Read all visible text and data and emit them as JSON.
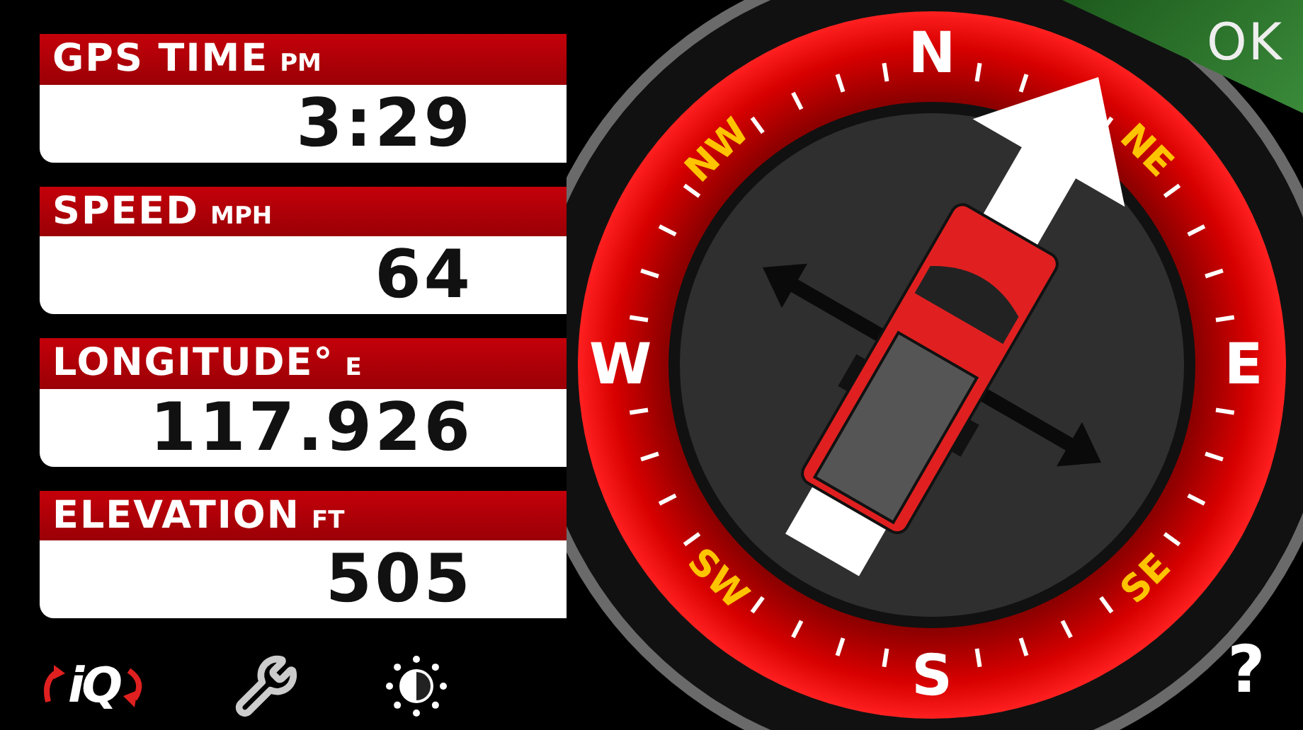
{
  "readouts": [
    {
      "label": "GPS TIME",
      "unit": "PM",
      "value": "3:29"
    },
    {
      "label": "SPEED",
      "unit": "MPH",
      "value": "64"
    },
    {
      "label": "LONGITUDE°",
      "unit": "E",
      "value": "117.926"
    },
    {
      "label": "ELEVATION",
      "unit": "FT",
      "value": "505"
    }
  ],
  "toolbar": {
    "logo": "iQ"
  },
  "compass": {
    "points": [
      {
        "label": "N",
        "kind": "cardinal"
      },
      {
        "label": "NE",
        "kind": "intercardinal"
      },
      {
        "label": "E",
        "kind": "cardinal"
      },
      {
        "label": "SE",
        "kind": "intercardinal"
      },
      {
        "label": "S",
        "kind": "cardinal"
      },
      {
        "label": "SW",
        "kind": "intercardinal"
      },
      {
        "label": "W",
        "kind": "cardinal"
      },
      {
        "label": "NW",
        "kind": "intercardinal"
      }
    ]
  },
  "ok_button": "OK",
  "help_button": "?"
}
